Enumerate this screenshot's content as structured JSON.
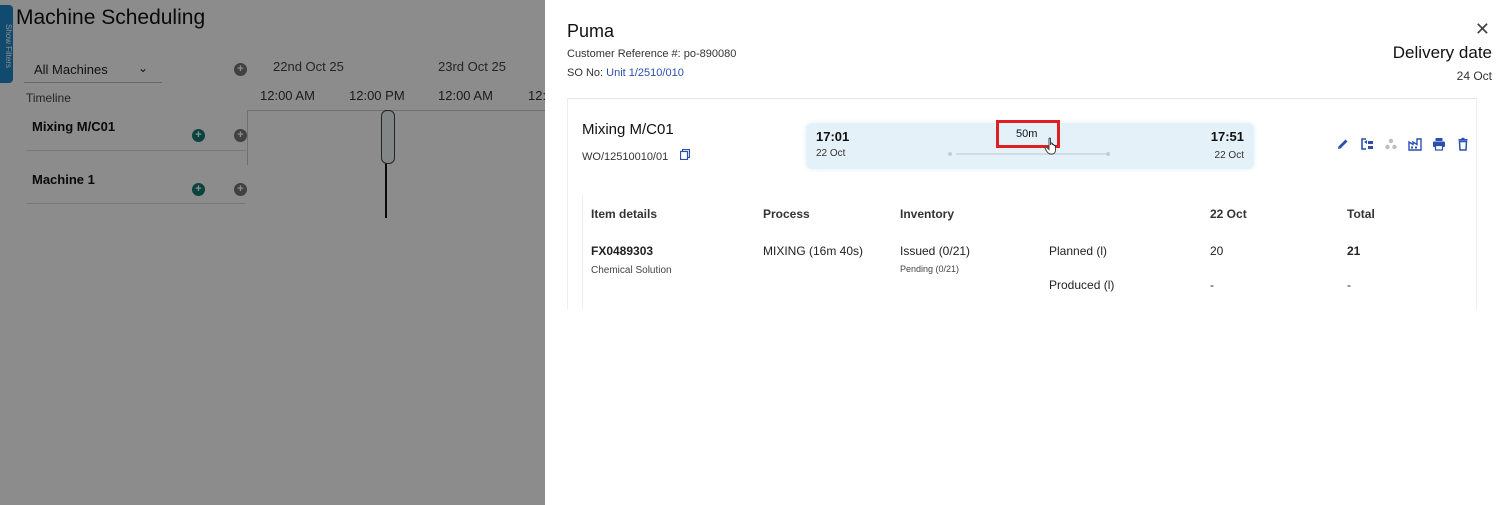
{
  "background": {
    "title": "Machine Scheduling",
    "filter_tab_label": "Show Filters",
    "machine_filter": "All Machines",
    "timeline_label": "Timeline",
    "dates": [
      "22nd Oct 25",
      "23rd Oct 25"
    ],
    "times": [
      "12:00 AM",
      "12:00 PM",
      "12:00 AM",
      "12:"
    ],
    "machines": [
      "Mixing M/C01",
      "Machine 1"
    ]
  },
  "drawer": {
    "customer_name": "Puma",
    "customer_reference_label": "Customer Reference #:",
    "customer_reference_value": "po-890080",
    "so_label": "SO No:",
    "so_value": "Unit 1/2510/010",
    "delivery_title": "Delivery date",
    "delivery_value": "24 Oct",
    "close_icon": "close-icon",
    "card": {
      "machine": "Mixing M/C01",
      "wo_number": "WO/12510010/01",
      "start_time": "17:01",
      "start_date": "22 Oct",
      "end_time": "17:51",
      "end_date": "22 Oct",
      "duration": "50m",
      "actions": [
        "edit-icon",
        "reassign-icon",
        "split-icon",
        "factory-icon",
        "print-icon",
        "delete-icon"
      ],
      "table": {
        "headers": [
          "Item details",
          "Process",
          "Inventory",
          "22 Oct",
          "Total"
        ],
        "item_code": "FX0489303",
        "item_name": "Chemical Solution",
        "process": "MIXING (16m 40s)",
        "inventory_issued": "Issued (0/21)",
        "inventory_pending": "Pending (0/21)",
        "rows": [
          {
            "label": "Planned (l)",
            "day": "20",
            "total": "21"
          },
          {
            "label": "Produced (l)",
            "day": "-",
            "total": "-"
          }
        ]
      }
    }
  }
}
